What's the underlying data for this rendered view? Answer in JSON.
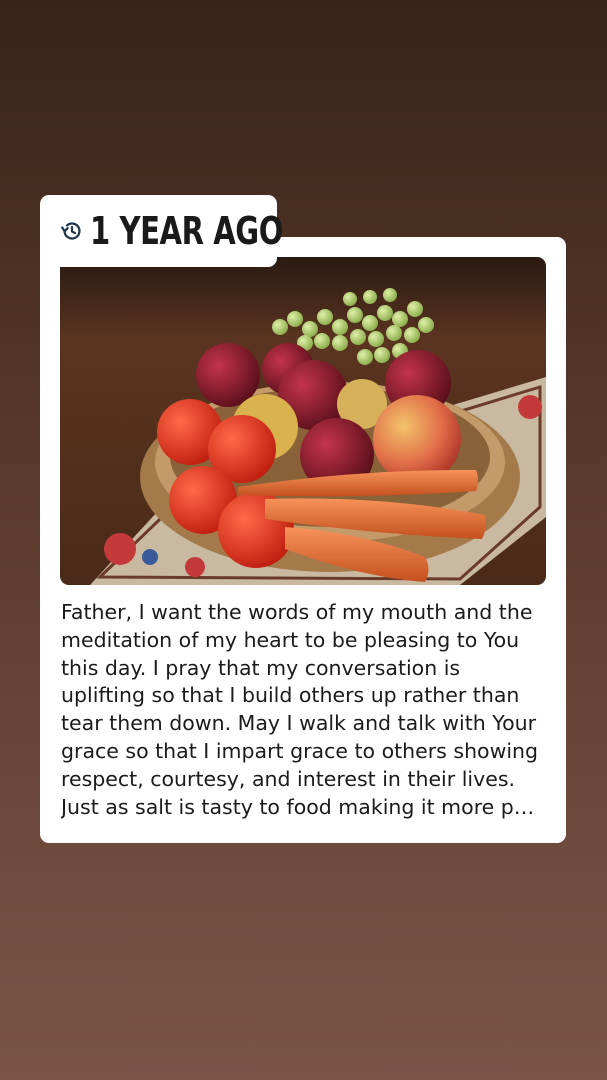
{
  "memory_card": {
    "time_label": "1 YEAR AGO",
    "history_icon": "history-clock-icon",
    "image_description_icon": "fruit-basket-photo",
    "caption": "Father, I want the words of my mouth and the\nmeditation of my heart to be pleasing to You\nthis day. I pray that my conversation is\nuplifting so that I build others up rather than\ntear them down. May I walk and talk with Your\ngrace so that I impart grace to others showing\nrespect, courtesy, and interest in their lives.\nJust as salt is tasty to food making it more p…"
  },
  "colors": {
    "background_top": "#3a2318",
    "background_bottom": "#7a5546",
    "card": "#ffffff",
    "text": "#1b1b1b",
    "icon": "#1f3447"
  }
}
